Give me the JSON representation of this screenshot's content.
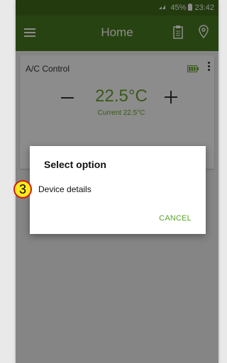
{
  "status_bar": {
    "battery_percent": "45%",
    "time": "23:42"
  },
  "app_bar": {
    "title": "Home",
    "icons": [
      "menu-icon",
      "clipboard-icon",
      "location-pin-icon"
    ]
  },
  "card": {
    "title": "A/C Control",
    "temperature": "22.5°C",
    "current": "Current 22.5°C",
    "icons": [
      "battery-icon",
      "more-vert-icon",
      "minus-icon",
      "plus-icon"
    ]
  },
  "dialog": {
    "title": "Select option",
    "option": "Device details",
    "cancel_label": "CANCEL"
  },
  "annotation": {
    "step": "3"
  },
  "colors": {
    "primary": "#4a7a21",
    "accent": "#6aa32f",
    "badge_fill": "#ffe91a",
    "badge_border": "#d21c1c"
  }
}
